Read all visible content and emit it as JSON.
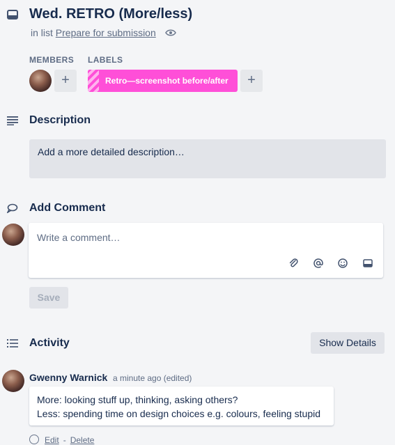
{
  "card": {
    "title": "Wed. RETRO (More/less)",
    "in_list_prefix": "in list",
    "list_name": "Prepare for submission",
    "icon": "card-icon"
  },
  "members": {
    "label": "MEMBERS",
    "add_label": "+"
  },
  "labels": {
    "label": "LABELS",
    "items": [
      {
        "text": "Retro—screenshot before/after",
        "color": "#ff4fd8"
      }
    ],
    "add_label": "+"
  },
  "description": {
    "title": "Description",
    "placeholder": "Add a more detailed description…"
  },
  "comment": {
    "title": "Add Comment",
    "placeholder": "Write a comment…",
    "toolbar_icons": [
      "attachment-icon",
      "mention-icon",
      "emoji-icon",
      "card-icon"
    ],
    "save_label": "Save"
  },
  "activity": {
    "title": "Activity",
    "show_details_label": "Show Details",
    "items": [
      {
        "author": "Gwenny Warnick",
        "time": "a minute ago (edited)",
        "lines": [
          "More: looking stuff up, thinking, asking others?",
          "Less: spending time on design choices e.g. colours, feeling stupid"
        ],
        "edit_label": "Edit",
        "separator": "-",
        "delete_label": "Delete"
      }
    ]
  },
  "colors": {
    "background": "#f4f5f7",
    "label_pink": "#ff4fd8",
    "text_primary": "#172b4d",
    "text_secondary": "#5e6c84"
  }
}
